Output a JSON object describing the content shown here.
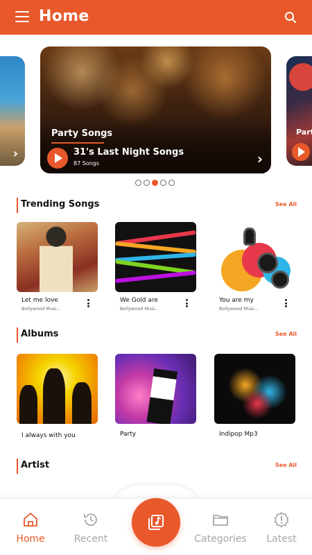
{
  "header": {
    "title": "Home"
  },
  "carousel": {
    "main": {
      "category": "Party Songs",
      "song": "31's Last Night Songs",
      "count": "87 Songs"
    },
    "right": {
      "category": "Part"
    },
    "dots": 5,
    "active_dot": 3
  },
  "sections": {
    "trending": {
      "title": "Trending Songs",
      "see_all": "See All",
      "items": [
        {
          "title": "Let me love",
          "subtitle": "Bollywood Musi..."
        },
        {
          "title": "We Gold are",
          "subtitle": "Bollywood Musi..."
        },
        {
          "title": "You are my",
          "subtitle": "Bollywood Musi..."
        }
      ]
    },
    "albums": {
      "title": "Albums",
      "see_all": "See All",
      "items": [
        {
          "title": "I always with you"
        },
        {
          "title": "Party"
        },
        {
          "title": "Indipop Mp3"
        }
      ]
    },
    "artist": {
      "title": "Artist",
      "see_all": "See All"
    }
  },
  "nav": {
    "items": [
      {
        "label": "Home",
        "icon": "home-icon",
        "active": true
      },
      {
        "label": "Recent",
        "icon": "history-icon",
        "active": false
      },
      {
        "label": "Categories",
        "icon": "folder-icon",
        "active": false
      },
      {
        "label": "Latest",
        "icon": "alert-badge-icon",
        "active": false
      }
    ],
    "fab_icon": "music-library-icon"
  },
  "colors": {
    "accent": "#E8582A",
    "inactive": "#A6A6A6"
  }
}
